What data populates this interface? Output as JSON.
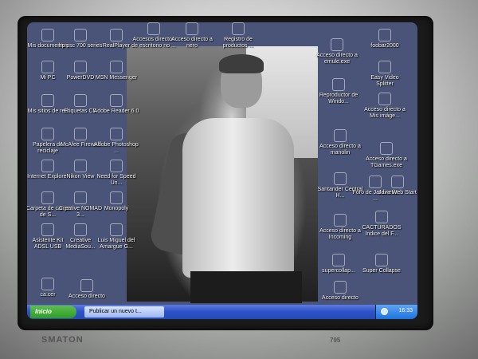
{
  "brand": "SMATON",
  "model": "795",
  "desktop": {
    "icons_left": [
      {
        "label": "Mis documentos",
        "icon": "folder-icon"
      },
      {
        "label": "hp psc 700 series",
        "icon": "printer-icon"
      },
      {
        "label": "RealPlayer",
        "icon": "realplayer-icon"
      },
      {
        "label": "Mi PC",
        "icon": "computer-icon"
      },
      {
        "label": "PowerDVD",
        "icon": "dvd-icon"
      },
      {
        "label": "MSN Messenger",
        "icon": "messenger-icon"
      },
      {
        "label": "Mis sitios de red",
        "icon": "network-icon"
      },
      {
        "label": "Etiquetas CD",
        "icon": "cd-label-icon"
      },
      {
        "label": "Adobe Reader 6.0",
        "icon": "adobe-reader-icon"
      },
      {
        "label": "Papelera de reciclaje",
        "icon": "recycle-bin-icon"
      },
      {
        "label": "McAfee Firewall",
        "icon": "mcafee-icon"
      },
      {
        "label": "Adobe Photoshop ...",
        "icon": "photoshop-icon"
      },
      {
        "label": "Internet Explorer",
        "icon": "ie-icon"
      },
      {
        "label": "Nikon View",
        "icon": "nikon-icon"
      },
      {
        "label": "Need for Speed Un...",
        "icon": "game-icon"
      },
      {
        "label": "Carpeta de carga de S...",
        "icon": "upload-folder-icon"
      },
      {
        "label": "Creative NOMAD 3...",
        "icon": "creative-icon"
      },
      {
        "label": "Monopoly",
        "icon": "monopoly-icon"
      },
      {
        "label": "Asistente Kit ADSL USB",
        "icon": "adsl-icon"
      },
      {
        "label": "Creative MediaSou...",
        "icon": "mediasource-icon"
      },
      {
        "label": "Luis Miguel del Amargue G...",
        "icon": "folder-icon"
      },
      {
        "label": "ca.cer",
        "icon": "certificate-icon"
      },
      {
        "label": "Acceso directo",
        "icon": "shortcut-icon"
      }
    ],
    "icons_top": [
      {
        "label": "Accesos directos de escritorio no ...",
        "icon": "folder-icon"
      },
      {
        "label": "Acceso directo a nero",
        "icon": "nero-icon"
      },
      {
        "label": "Registro de productos ...",
        "icon": "register-icon"
      }
    ],
    "icons_right": [
      {
        "label": "Acceso directo a emule.exe",
        "icon": "emule-icon"
      },
      {
        "label": "foobar2000",
        "icon": "foobar-icon"
      },
      {
        "label": "Reproductor de Windo...",
        "icon": "media-player-icon"
      },
      {
        "label": "Easy Video Splitter",
        "icon": "video-splitter-icon"
      },
      {
        "label": "Acceso directo a Mis imáge...",
        "icon": "pictures-icon"
      },
      {
        "label": "Acceso directo a manolin",
        "icon": "folder-icon"
      },
      {
        "label": "Acceso directo a TGames.exe",
        "icon": "tgames-icon"
      },
      {
        "label": "Santander Central H...",
        "icon": "bank-icon"
      },
      {
        "label": "Foro de Jardineria ...",
        "icon": "web-icon"
      },
      {
        "label": "Java Web Start",
        "icon": "java-icon"
      },
      {
        "label": "Acceso directo a Incoming",
        "icon": "folder-icon"
      },
      {
        "label": "CACTURADOS Indice del F...",
        "icon": "web-icon"
      },
      {
        "label": "supercollap...",
        "icon": "game-icon"
      },
      {
        "label": "Super Collapse",
        "icon": "collapse-icon"
      },
      {
        "label": "Acceso directo",
        "icon": "shortcut-icon"
      }
    ]
  },
  "taskbar": {
    "start_label": "Inicio",
    "task_label": "Publicar un nuevo t...",
    "clock": "16:33"
  }
}
